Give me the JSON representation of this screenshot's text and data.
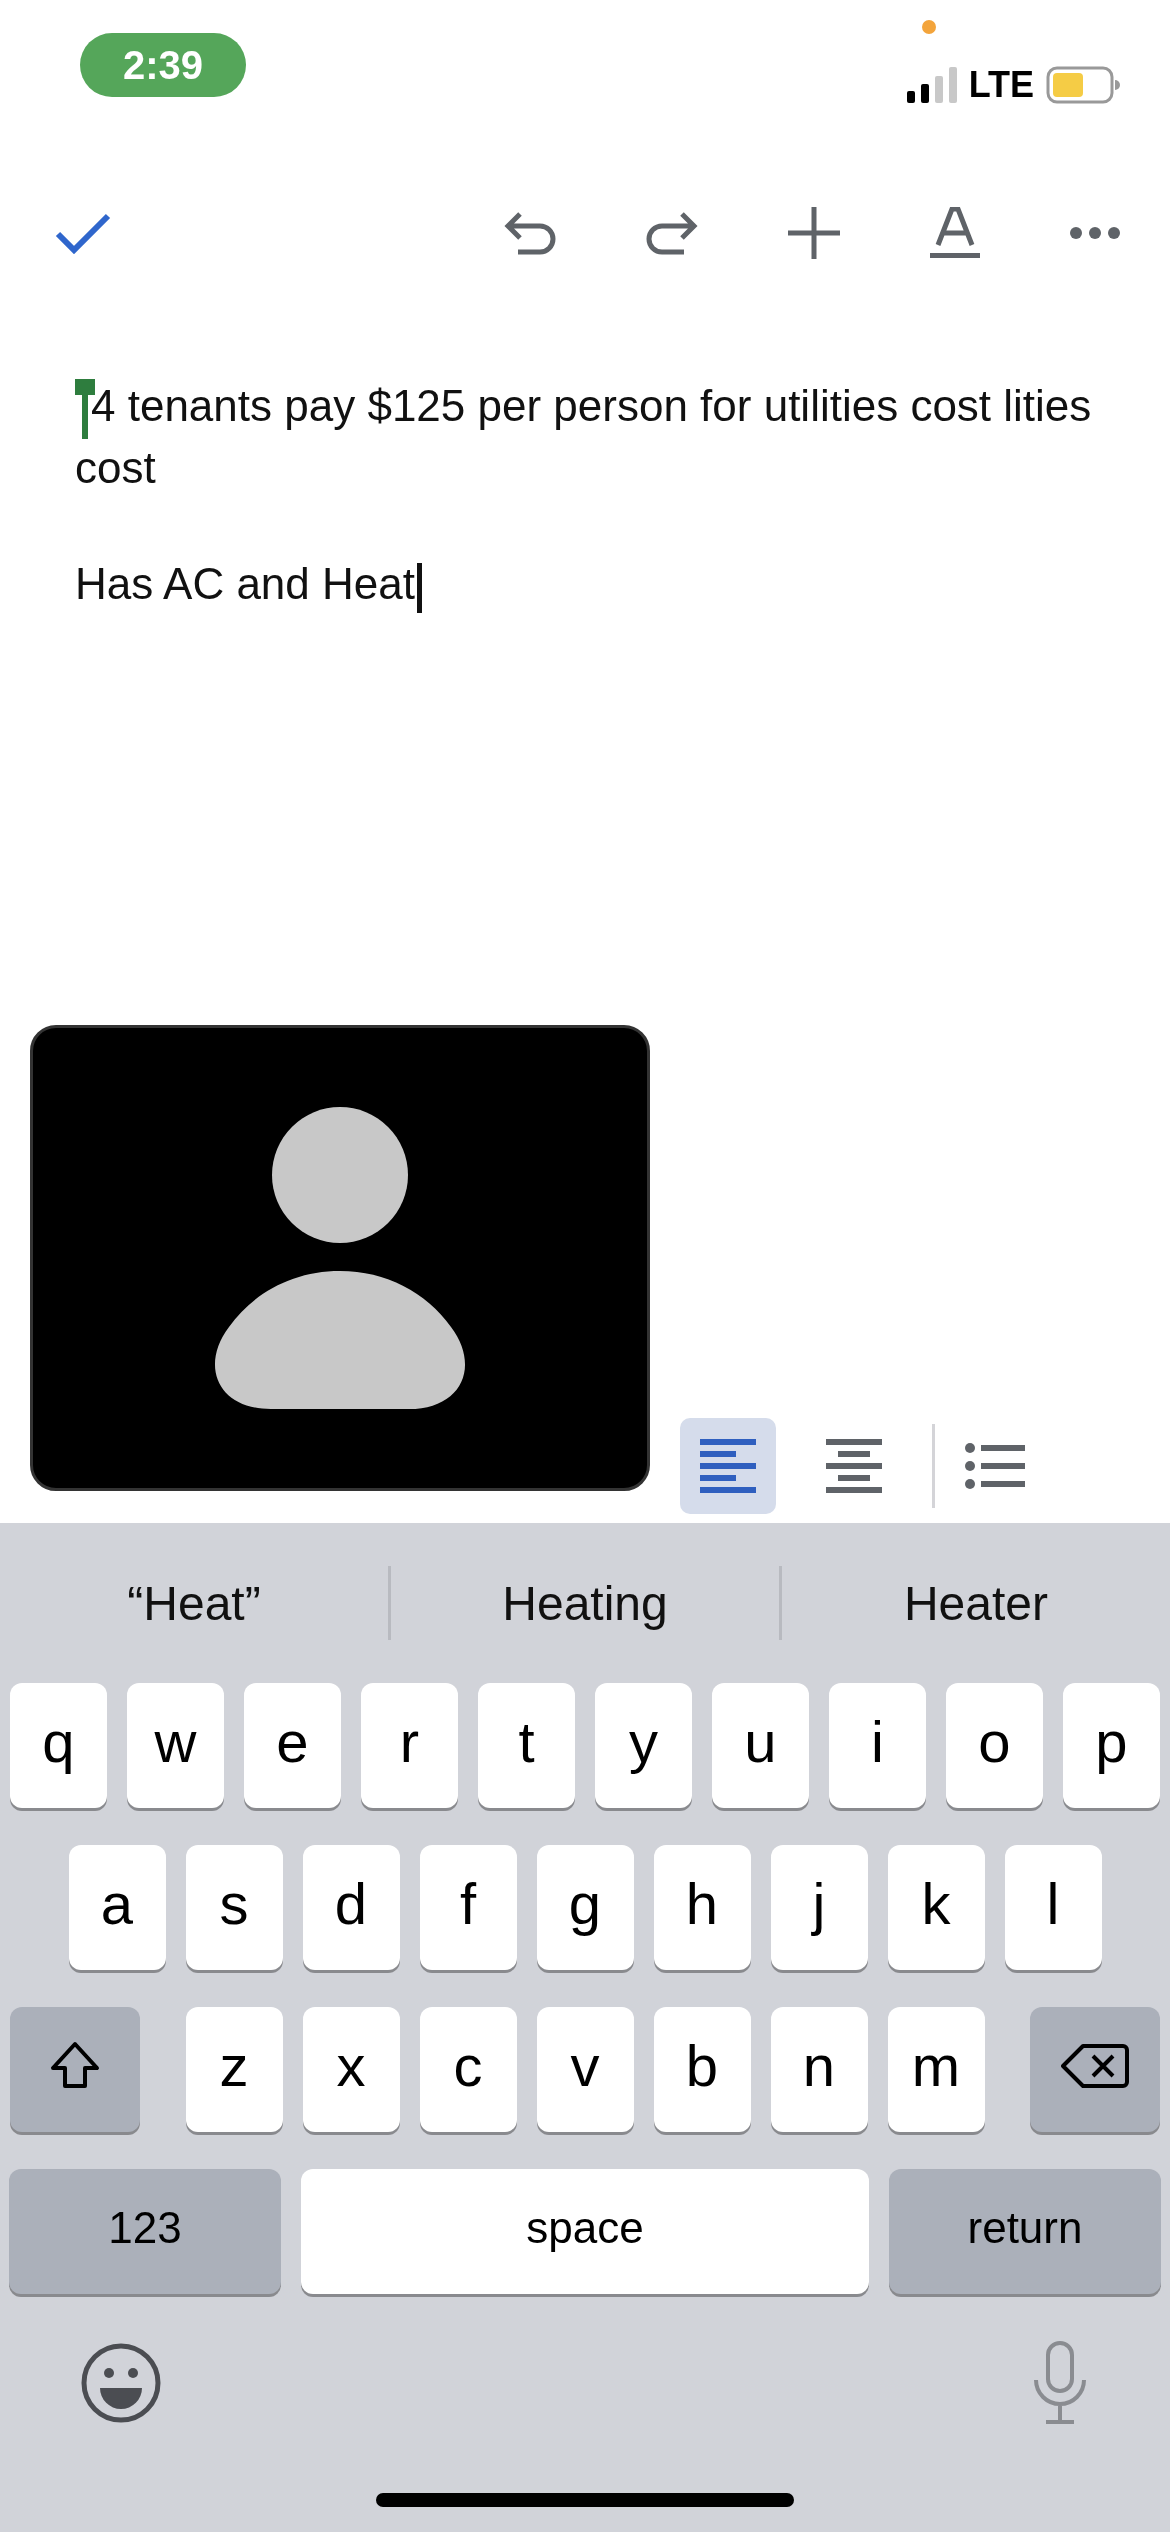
{
  "status_bar": {
    "time": "2:39",
    "network": "LTE"
  },
  "document": {
    "paragraphs": [
      {
        "text": "4 tenants pay $125 per person for utilities cost lities cost",
        "selection_handle": true,
        "cursor": false
      },
      {
        "text": "Has AC and Heat",
        "selection_handle": false,
        "cursor": true
      }
    ]
  },
  "format_bar": {
    "alignments": [
      {
        "kind": "left",
        "selected": true
      },
      {
        "kind": "center",
        "selected": false
      }
    ]
  },
  "keyboard": {
    "suggestions": [
      "“Heat”",
      "Heating",
      "Heater"
    ],
    "rows": [
      {
        "keys": [
          {
            "kind": "letter",
            "label": "q"
          },
          {
            "kind": "letter",
            "label": "w"
          },
          {
            "kind": "letter",
            "label": "e"
          },
          {
            "kind": "letter",
            "label": "r"
          },
          {
            "kind": "letter",
            "label": "t"
          },
          {
            "kind": "letter",
            "label": "y"
          },
          {
            "kind": "letter",
            "label": "u"
          },
          {
            "kind": "letter",
            "label": "i"
          },
          {
            "kind": "letter",
            "label": "o"
          },
          {
            "kind": "letter",
            "label": "p"
          }
        ]
      },
      {
        "keys": [
          {
            "kind": "letter",
            "label": "a"
          },
          {
            "kind": "letter",
            "label": "s"
          },
          {
            "kind": "letter",
            "label": "d"
          },
          {
            "kind": "letter",
            "label": "f"
          },
          {
            "kind": "letter",
            "label": "g"
          },
          {
            "kind": "letter",
            "label": "h"
          },
          {
            "kind": "letter",
            "label": "j"
          },
          {
            "kind": "letter",
            "label": "k"
          },
          {
            "kind": "letter",
            "label": "l"
          }
        ]
      },
      {
        "keys": [
          {
            "kind": "shift"
          },
          {
            "kind": "letter",
            "label": "z"
          },
          {
            "kind": "letter",
            "label": "x"
          },
          {
            "kind": "letter",
            "label": "c"
          },
          {
            "kind": "letter",
            "label": "v"
          },
          {
            "kind": "letter",
            "label": "b"
          },
          {
            "kind": "letter",
            "label": "n"
          },
          {
            "kind": "letter",
            "label": "m"
          },
          {
            "kind": "delete"
          }
        ]
      },
      {
        "keys": [
          {
            "kind": "mode",
            "label": "123"
          },
          {
            "kind": "space",
            "label": "space"
          },
          {
            "kind": "return",
            "label": "return"
          }
        ]
      }
    ]
  }
}
